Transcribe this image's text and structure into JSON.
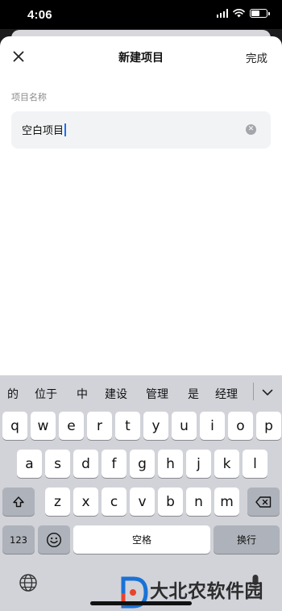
{
  "status": {
    "time": "4:06"
  },
  "nav": {
    "title": "新建项目",
    "done_label": "完成"
  },
  "form": {
    "label": "项目名称",
    "value": "空白项目"
  },
  "keyboard": {
    "suggestions": [
      "的",
      "位于",
      "中",
      "建设",
      "管理",
      "是",
      "经理"
    ],
    "row1": [
      "q",
      "w",
      "e",
      "r",
      "t",
      "y",
      "u",
      "i",
      "o",
      "p"
    ],
    "row2": [
      "a",
      "s",
      "d",
      "f",
      "g",
      "h",
      "j",
      "k",
      "l"
    ],
    "row3": [
      "z",
      "x",
      "c",
      "v",
      "b",
      "n",
      "m"
    ],
    "numbers_label": "123",
    "space_label": "空格",
    "return_label": "换行"
  },
  "watermark": {
    "text": "大北农软件园"
  }
}
